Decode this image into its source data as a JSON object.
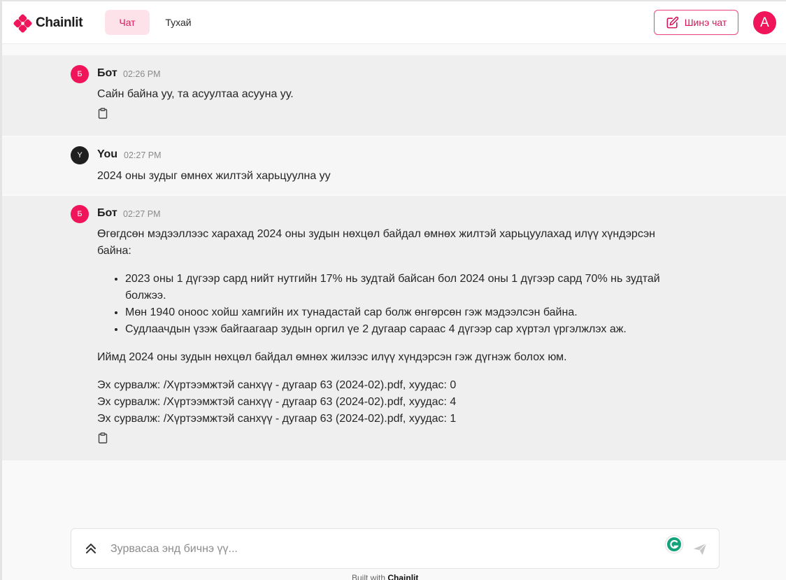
{
  "header": {
    "logo_text": "Chainlit",
    "tabs": [
      {
        "label": "Чат",
        "active": true
      },
      {
        "label": "Тухай",
        "active": false
      }
    ],
    "new_chat_label": "Шинэ чат",
    "user_avatar_letter": "A",
    "accent_color": "#f0145a"
  },
  "messages": [
    {
      "role": "bot",
      "avatar_letter": "Б",
      "author": "Бот",
      "time": "02:26 PM",
      "text": "Сайн байна уу, та асуултаа асууна уу."
    },
    {
      "role": "user",
      "avatar_letter": "Y",
      "author": "You",
      "time": "02:27 PM",
      "text": "2024 оны зудыг өмнөх жилтэй харьцуулна уу"
    },
    {
      "role": "bot",
      "avatar_letter": "Б",
      "author": "Бот",
      "time": "02:27 PM",
      "intro": "Өгөгдсөн мэдээллээс харахад 2024 оны зудын нөхцөл байдал өмнөх жилтэй харьцуулахад илүү хүндэрсэн байна:",
      "bullets": [
        "2023 оны 1 дүгээр сард нийт нутгийн 17% нь зудтай байсан бол 2024 оны 1 дүгээр сард 70% нь зудтай болжээ.",
        "Мөн 1940 оноос хойш хамгийн их тунадастай сар болж өнгөрсөн гэж мэдээлсэн байна.",
        "Судлаачдын үзэж байгаагаар зудын оргил үе 2 дугаар сараас 4 дүгээр сар хүртэл үргэлжлэх аж."
      ],
      "conclusion": "Иймд 2024 оны зудын нөхцөл байдал өмнөх жилээс илүү хүндэрсэн гэж дүгнэж болох юм.",
      "sources": [
        "Эх сурвалж: /Хүртээмжтэй санхүү - дугаар 63 (2024-02).pdf, хуудас: 0",
        "Эх сурвалж: /Хүртээмжтэй санхүү - дугаар 63 (2024-02).pdf, хуудас: 4",
        "Эх сурвалж: /Хүртээмжтэй санхүү - дугаар 63 (2024-02).pdf, хуудас: 1"
      ]
    }
  ],
  "composer": {
    "placeholder": "Зурвасаа энд бичнэ үү..."
  },
  "footer": {
    "built_with": "Built with",
    "brand": "Chainlit"
  }
}
